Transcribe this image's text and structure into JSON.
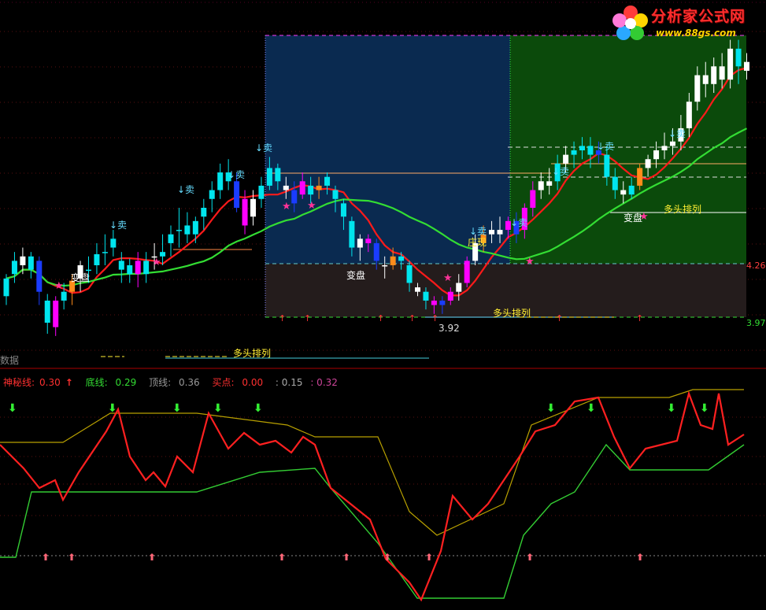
{
  "logo": {
    "title": "分析家公式网",
    "url": "www.88gs.com"
  },
  "main_panel": {
    "price_labels": {
      "low_marker": "3.92",
      "right_upper": "4.26",
      "right_lower": "3.97"
    },
    "annotations": {
      "sell": "↓卖",
      "change": "变盘",
      "bull_array": "多头排列",
      "zhuang": "庄现"
    }
  },
  "data_label": "数据",
  "data_strip_text": "多头排列",
  "indicator": {
    "mystery_label": "神秘线:",
    "mystery_value": "0.30",
    "bottom_label": "底线:",
    "bottom_value": "0.29",
    "top_label": "顶线:",
    "top_value": "0.36",
    "buy_label": "买点:",
    "buy_value": "0.00",
    "v5": ": 0.15",
    "v6": ": 0.32"
  },
  "colors": {
    "up": "#ff00ff",
    "down": "#00e5ee",
    "blue": "#1a3cff",
    "orange": "#ff8c1a",
    "ma_red": "#ff1a1a",
    "ma_green": "#33dd33",
    "zone_blue": "#0a2a50",
    "zone_green": "#0b4a0b",
    "zone_gray": "#241c1c",
    "mystery": "#ff2020",
    "top_line": "#b8a000",
    "bottom_line": "#33cc33"
  },
  "chart_data": {
    "type": "candlestick",
    "candles": [
      [
        0,
        3.92,
        4.0,
        3.88,
        4.02,
        "cyan"
      ],
      [
        1,
        4.08,
        4.02,
        3.98,
        4.12,
        "cyan"
      ],
      [
        2,
        4.06,
        4.1,
        4.02,
        4.14,
        "white"
      ],
      [
        3,
        4.1,
        4.04,
        4.0,
        4.12,
        "cyan"
      ],
      [
        4,
        4.08,
        3.94,
        3.88,
        4.1,
        "blue"
      ],
      [
        5,
        3.9,
        3.8,
        3.75,
        3.93,
        "cyan"
      ],
      [
        6,
        3.78,
        3.9,
        3.74,
        3.92,
        "pink"
      ],
      [
        7,
        3.9,
        3.94,
        3.86,
        3.98,
        "cyan"
      ],
      [
        8,
        3.94,
        3.99,
        3.88,
        4.02,
        "orange"
      ],
      [
        9,
        4.0,
        4.06,
        3.94,
        4.08,
        "white"
      ],
      [
        10,
        4.04,
        4.04,
        3.98,
        4.1,
        "cyan"
      ],
      [
        11,
        4.06,
        4.11,
        4.02,
        4.16,
        "cyan"
      ],
      [
        12,
        4.12,
        4.12,
        4.06,
        4.2,
        "cyan"
      ],
      [
        13,
        4.14,
        4.18,
        4.1,
        4.22,
        "cyan"
      ],
      [
        14,
        4.08,
        4.04,
        3.98,
        4.12,
        "cyan"
      ],
      [
        15,
        4.02,
        4.06,
        3.98,
        4.09,
        "cyan"
      ],
      [
        16,
        4.08,
        4.02,
        3.96,
        4.12,
        "pink"
      ],
      [
        17,
        4.02,
        4.08,
        3.98,
        4.12,
        "cyan"
      ],
      [
        18,
        4.1,
        4.1,
        4.04,
        4.16,
        "white"
      ],
      [
        19,
        4.12,
        4.1,
        4.06,
        4.2,
        "cyan"
      ],
      [
        20,
        4.16,
        4.2,
        4.1,
        4.24,
        "cyan"
      ],
      [
        21,
        4.22,
        4.22,
        4.14,
        4.32,
        "cyan"
      ],
      [
        22,
        4.24,
        4.2,
        4.16,
        4.3,
        "cyan"
      ],
      [
        23,
        4.2,
        4.26,
        4.16,
        4.28,
        "cyan"
      ],
      [
        24,
        4.28,
        4.32,
        4.22,
        4.36,
        "cyan"
      ],
      [
        25,
        4.36,
        4.4,
        4.3,
        4.44,
        "cyan"
      ],
      [
        26,
        4.4,
        4.48,
        4.36,
        4.52,
        "cyan"
      ],
      [
        27,
        4.48,
        4.44,
        4.4,
        4.54,
        "cyan"
      ],
      [
        28,
        4.44,
        4.32,
        4.3,
        4.48,
        "blue"
      ],
      [
        29,
        4.36,
        4.24,
        4.2,
        4.4,
        "pink"
      ],
      [
        30,
        4.28,
        4.36,
        4.24,
        4.4,
        "white"
      ],
      [
        31,
        4.36,
        4.42,
        4.32,
        4.46,
        "cyan"
      ],
      [
        32,
        4.42,
        4.5,
        4.4,
        4.55,
        "cyan"
      ],
      [
        33,
        4.5,
        4.44,
        4.4,
        4.52,
        "cyan"
      ],
      [
        34,
        4.42,
        4.4,
        4.36,
        4.46,
        "white"
      ],
      [
        35,
        4.4,
        4.34,
        4.3,
        4.44,
        "blue"
      ],
      [
        36,
        4.38,
        4.44,
        4.36,
        4.48,
        "pink"
      ],
      [
        37,
        4.42,
        4.38,
        4.34,
        4.46,
        "cyan"
      ],
      [
        38,
        4.4,
        4.42,
        4.36,
        4.46,
        "orange"
      ],
      [
        39,
        4.42,
        4.46,
        4.38,
        4.48,
        "cyan"
      ],
      [
        40,
        4.4,
        4.36,
        4.3,
        4.42,
        "cyan"
      ],
      [
        41,
        4.34,
        4.28,
        4.22,
        4.36,
        "cyan"
      ],
      [
        42,
        4.26,
        4.14,
        4.1,
        4.28,
        "cyan"
      ],
      [
        43,
        4.14,
        4.18,
        4.08,
        4.2,
        "white"
      ],
      [
        44,
        4.18,
        4.16,
        4.12,
        4.2,
        "pink"
      ],
      [
        45,
        4.16,
        4.08,
        4.04,
        4.18,
        "blue"
      ],
      [
        46,
        4.06,
        4.06,
        4.0,
        4.1,
        "white"
      ],
      [
        47,
        4.06,
        4.1,
        4.04,
        4.14,
        "orange"
      ],
      [
        48,
        4.1,
        4.08,
        4.04,
        4.12,
        "cyan"
      ],
      [
        49,
        4.06,
        3.98,
        3.94,
        4.08,
        "cyan"
      ],
      [
        50,
        3.96,
        3.94,
        3.92,
        3.98,
        "white"
      ],
      [
        51,
        3.94,
        3.9,
        3.86,
        3.96,
        "cyan"
      ],
      [
        52,
        3.9,
        3.88,
        3.84,
        3.92,
        "pink"
      ],
      [
        53,
        3.88,
        3.9,
        3.84,
        3.92,
        "blue"
      ],
      [
        54,
        3.9,
        3.94,
        3.88,
        3.96,
        "pink"
      ],
      [
        55,
        3.94,
        3.98,
        3.9,
        4.02,
        "white"
      ],
      [
        56,
        3.98,
        4.08,
        3.96,
        4.1,
        "pink"
      ],
      [
        57,
        4.08,
        4.16,
        4.06,
        4.2,
        "white"
      ],
      [
        58,
        4.16,
        4.2,
        4.12,
        4.24,
        "orange"
      ],
      [
        59,
        4.2,
        4.22,
        4.16,
        4.26,
        "white"
      ],
      [
        60,
        4.22,
        4.2,
        4.16,
        4.28,
        "white"
      ],
      [
        61,
        4.22,
        4.26,
        4.18,
        4.28,
        "pink"
      ],
      [
        62,
        4.26,
        4.2,
        4.16,
        4.3,
        "blue"
      ],
      [
        63,
        4.22,
        4.32,
        4.18,
        4.34,
        "pink"
      ],
      [
        64,
        4.32,
        4.4,
        4.28,
        4.44,
        "pink"
      ],
      [
        65,
        4.4,
        4.44,
        4.36,
        4.48,
        "white"
      ],
      [
        66,
        4.44,
        4.42,
        4.38,
        4.5,
        "white"
      ],
      [
        67,
        4.44,
        4.52,
        4.4,
        4.56,
        "cyan"
      ],
      [
        68,
        4.52,
        4.56,
        4.48,
        4.6,
        "white"
      ],
      [
        69,
        4.56,
        4.58,
        4.5,
        4.62,
        "cyan"
      ],
      [
        70,
        4.58,
        4.6,
        4.54,
        4.64,
        "cyan"
      ],
      [
        71,
        4.6,
        4.56,
        4.5,
        4.64,
        "cyan"
      ],
      [
        72,
        4.56,
        4.58,
        4.52,
        4.62,
        "blue"
      ],
      [
        73,
        4.56,
        4.46,
        4.42,
        4.6,
        "cyan"
      ],
      [
        74,
        4.46,
        4.4,
        4.36,
        4.5,
        "cyan"
      ],
      [
        75,
        4.4,
        4.38,
        4.34,
        4.44,
        "white"
      ],
      [
        76,
        4.38,
        4.42,
        4.36,
        4.46,
        "cyan"
      ],
      [
        77,
        4.42,
        4.5,
        4.4,
        4.52,
        "orange"
      ],
      [
        78,
        4.5,
        4.54,
        4.46,
        4.56,
        "white"
      ],
      [
        79,
        4.54,
        4.58,
        4.5,
        4.62,
        "white"
      ],
      [
        80,
        4.58,
        4.6,
        4.54,
        4.66,
        "white"
      ],
      [
        81,
        4.6,
        4.62,
        4.56,
        4.68,
        "white"
      ],
      [
        82,
        4.62,
        4.68,
        4.58,
        4.74,
        "white"
      ],
      [
        83,
        4.68,
        4.8,
        4.64,
        4.84,
        "white"
      ],
      [
        84,
        4.8,
        4.92,
        4.76,
        4.96,
        "white"
      ],
      [
        85,
        4.92,
        4.88,
        4.82,
        4.98,
        "white"
      ],
      [
        86,
        4.88,
        4.96,
        4.84,
        5.0,
        "white"
      ],
      [
        87,
        4.96,
        4.9,
        4.86,
        5.02,
        "white"
      ],
      [
        88,
        4.9,
        5.04,
        4.86,
        5.08,
        "white"
      ],
      [
        89,
        5.04,
        4.96,
        4.88,
        5.08,
        "cyan"
      ],
      [
        90,
        4.94,
        4.98,
        4.9,
        5.02,
        "white"
      ]
    ]
  }
}
